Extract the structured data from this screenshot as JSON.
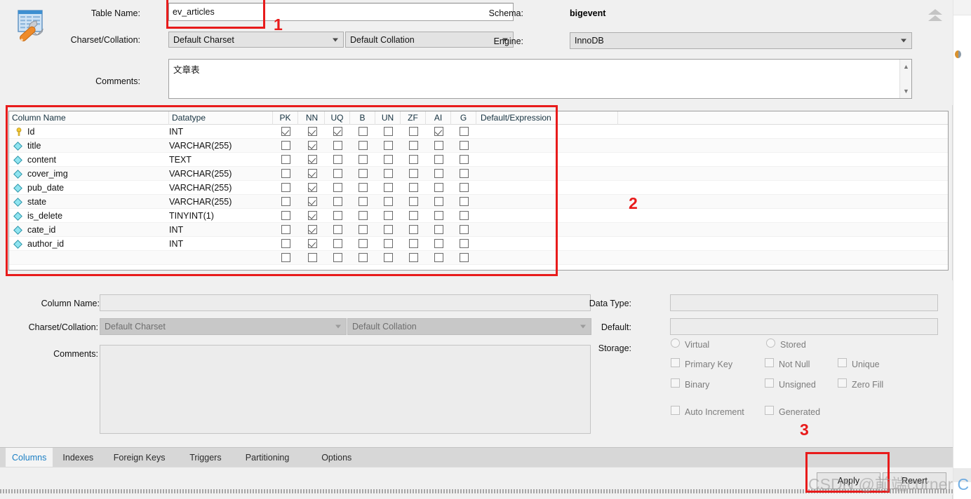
{
  "header": {
    "table_name_label": "Table Name:",
    "table_name_value": "ev_articles",
    "schema_label": "Schema:",
    "schema_value": "bigevent",
    "charset_label": "Charset/Collation:",
    "charset_value": "Default Charset",
    "collation_value": "Default Collation",
    "engine_label": "Engine:",
    "engine_value": "InnoDB",
    "comments_label": "Comments:",
    "comments_value": "文章表",
    "icon": "table-wrench-icon",
    "collapse_icon": "double-chevron-up-icon"
  },
  "grid": {
    "headers": [
      "Column Name",
      "Datatype",
      "PK",
      "NN",
      "UQ",
      "B",
      "UN",
      "ZF",
      "AI",
      "G",
      "Default/Expression"
    ],
    "rows": [
      {
        "icon": "primary-key-icon",
        "name": "Id",
        "datatype": "INT",
        "pk": true,
        "nn": true,
        "uq": true,
        "b": false,
        "un": false,
        "zf": false,
        "ai": true,
        "g": false,
        "default": ""
      },
      {
        "icon": "column-icon",
        "name": "title",
        "datatype": "VARCHAR(255)",
        "pk": false,
        "nn": true,
        "uq": false,
        "b": false,
        "un": false,
        "zf": false,
        "ai": false,
        "g": false,
        "default": ""
      },
      {
        "icon": "column-icon",
        "name": "content",
        "datatype": "TEXT",
        "pk": false,
        "nn": true,
        "uq": false,
        "b": false,
        "un": false,
        "zf": false,
        "ai": false,
        "g": false,
        "default": ""
      },
      {
        "icon": "column-icon",
        "name": "cover_img",
        "datatype": "VARCHAR(255)",
        "pk": false,
        "nn": true,
        "uq": false,
        "b": false,
        "un": false,
        "zf": false,
        "ai": false,
        "g": false,
        "default": ""
      },
      {
        "icon": "column-icon",
        "name": "pub_date",
        "datatype": "VARCHAR(255)",
        "pk": false,
        "nn": true,
        "uq": false,
        "b": false,
        "un": false,
        "zf": false,
        "ai": false,
        "g": false,
        "default": ""
      },
      {
        "icon": "column-icon",
        "name": "state",
        "datatype": "VARCHAR(255)",
        "pk": false,
        "nn": true,
        "uq": false,
        "b": false,
        "un": false,
        "zf": false,
        "ai": false,
        "g": false,
        "default": ""
      },
      {
        "icon": "column-icon",
        "name": "is_delete",
        "datatype": "TINYINT(1)",
        "pk": false,
        "nn": true,
        "uq": false,
        "b": false,
        "un": false,
        "zf": false,
        "ai": false,
        "g": false,
        "default": ""
      },
      {
        "icon": "column-icon",
        "name": "cate_id",
        "datatype": "INT",
        "pk": false,
        "nn": true,
        "uq": false,
        "b": false,
        "un": false,
        "zf": false,
        "ai": false,
        "g": false,
        "default": ""
      },
      {
        "icon": "column-icon",
        "name": "author_id",
        "datatype": "INT",
        "pk": false,
        "nn": true,
        "uq": false,
        "b": false,
        "un": false,
        "zf": false,
        "ai": false,
        "g": false,
        "default": ""
      },
      {
        "icon": "",
        "name": "",
        "datatype": "",
        "pk": false,
        "nn": false,
        "uq": false,
        "b": false,
        "un": false,
        "zf": false,
        "ai": false,
        "g": false,
        "default": ""
      }
    ]
  },
  "detail": {
    "column_name_label": "Column Name:",
    "column_name_value": "",
    "charset_label": "Charset/Collation:",
    "charset_value": "Default Charset",
    "collation_value": "Default Collation",
    "comments_label": "Comments:",
    "comments_value": "",
    "data_type_label": "Data Type:",
    "data_type_value": "",
    "default_label": "Default:",
    "default_value": "",
    "storage_label": "Storage:",
    "storage_options": [
      "Virtual",
      "Stored"
    ],
    "flags_row1": [
      "Primary Key",
      "Not Null",
      "Unique"
    ],
    "flags_row2": [
      "Binary",
      "Unsigned",
      "Zero Fill"
    ],
    "flags_row3": [
      "Auto Increment",
      "Generated"
    ]
  },
  "tabs": [
    {
      "label": "Columns",
      "active": true
    },
    {
      "label": "Indexes",
      "active": false
    },
    {
      "label": "Foreign Keys",
      "active": false
    },
    {
      "label": "Triggers",
      "active": false
    },
    {
      "label": "Partitioning",
      "active": false
    },
    {
      "label": "Options",
      "active": false
    }
  ],
  "footer": {
    "apply_label": "Apply",
    "revert_label": "Revert"
  },
  "annotations": [
    {
      "num": "1"
    },
    {
      "num": "2"
    },
    {
      "num": "3"
    }
  ],
  "watermark": {
    "text": "CSDN @前端corner ",
    "suffix": "C"
  },
  "colors": {
    "annotation_red": "#e81b1b",
    "active_tab_blue": "#1b7fc4",
    "key_yellow": "#f2c832",
    "column_cyan": "#8fe4f0"
  }
}
